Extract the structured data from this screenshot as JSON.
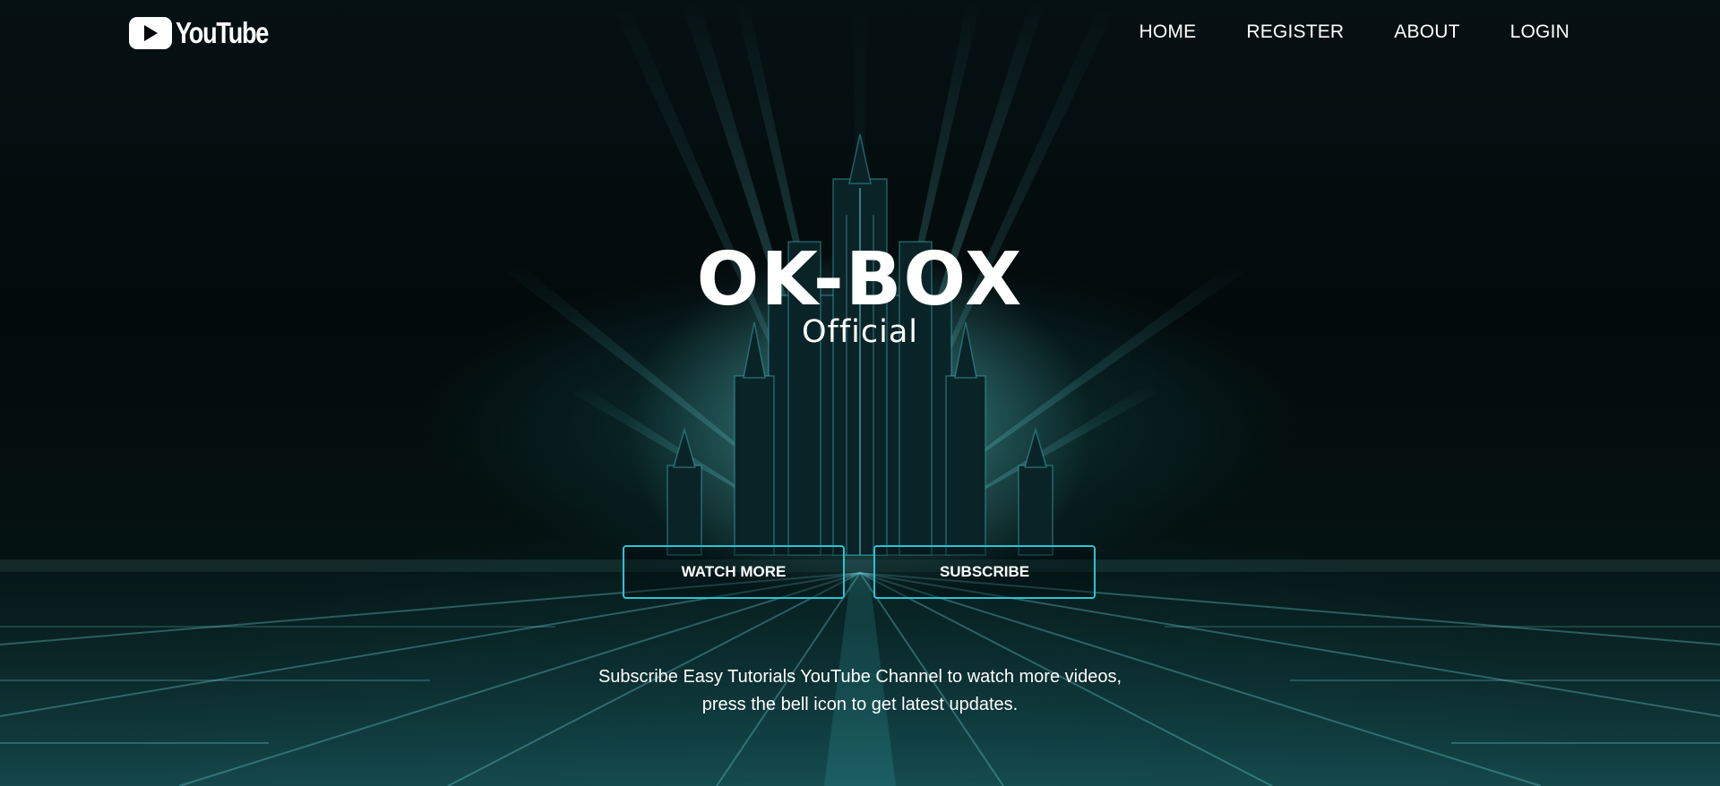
{
  "brand": {
    "logo_text": "YouTube",
    "logo_icon": "youtube-play-icon"
  },
  "nav": {
    "items": [
      {
        "label": "HOME"
      },
      {
        "label": "REGISTER"
      },
      {
        "label": "ABOUT"
      },
      {
        "label": "LOGIN"
      }
    ]
  },
  "hero": {
    "title": "OK-BOX",
    "subtitle": "Official",
    "buttons": {
      "watch_more": "WATCH MORE",
      "subscribe": "SUBSCRIBE"
    },
    "tagline_line1": "Subscribe Easy Tutorials YouTube Channel to watch more videos,",
    "tagline_line2": "press the bell icon to get latest updates."
  },
  "colors": {
    "accent": "#28c6d4",
    "background": "#030a0b",
    "text": "#ffffff"
  }
}
